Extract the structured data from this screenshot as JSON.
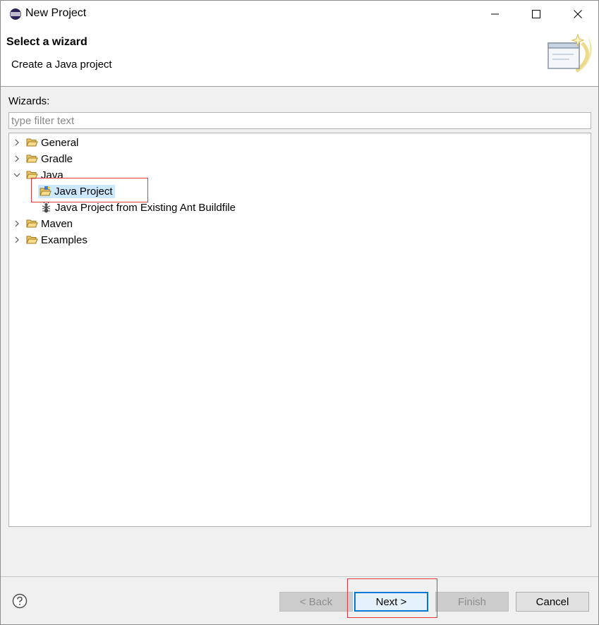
{
  "window": {
    "title": "New Project",
    "controls": {
      "minimize": "minimize",
      "maximize": "maximize",
      "close": "close"
    }
  },
  "banner": {
    "title": "Select a wizard",
    "description": "Create a Java project",
    "image": "wizard-banner-icon"
  },
  "wizards": {
    "label": "Wizards:",
    "filter_placeholder": "type filter text",
    "filter_value": "",
    "tree": [
      {
        "label": "General",
        "expanded": false,
        "icon": "folder-icon"
      },
      {
        "label": "Gradle",
        "expanded": false,
        "icon": "folder-icon"
      },
      {
        "label": "Java",
        "expanded": true,
        "icon": "folder-icon",
        "children": [
          {
            "label": "Java Project",
            "icon": "java-project-icon",
            "selected": true
          },
          {
            "label": "Java Project from Existing Ant Buildfile",
            "icon": "ant-icon"
          }
        ]
      },
      {
        "label": "Maven",
        "expanded": false,
        "icon": "folder-icon"
      },
      {
        "label": "Examples",
        "expanded": false,
        "icon": "folder-icon"
      }
    ]
  },
  "footer": {
    "help_icon": "help-icon",
    "back_label": "< Back",
    "next_label": "Next >",
    "finish_label": "Finish",
    "cancel_label": "Cancel"
  },
  "colors": {
    "selection": "#cce8ff",
    "annotation": "#e0393e",
    "default_button_border": "#0078d7"
  }
}
